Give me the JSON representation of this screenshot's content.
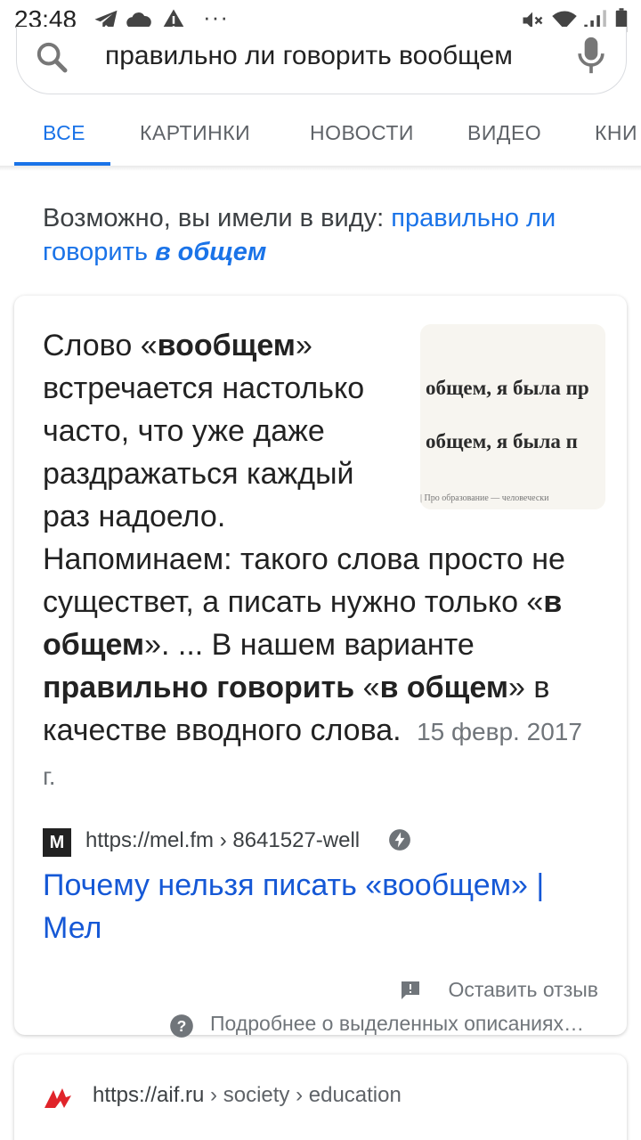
{
  "status_bar": {
    "time": "23:48",
    "dots": "···",
    "left_icons": [
      "telegram-icon",
      "cloud-icon",
      "warning-icon"
    ],
    "right_icons": [
      "mute-icon",
      "wifi-icon",
      "signal-icon",
      "battery-icon"
    ]
  },
  "search": {
    "query": "правильно ли говорить вообщем",
    "icons": [
      "search-icon",
      "mic-icon"
    ]
  },
  "tabs": [
    {
      "label": "ВСЕ",
      "active": true
    },
    {
      "label": "КАРТИНКИ",
      "active": false
    },
    {
      "label": "НОВОСТИ",
      "active": false
    },
    {
      "label": "ВИДЕО",
      "active": false
    },
    {
      "label": "КНИ",
      "active": false
    }
  ],
  "did_you_mean": {
    "prefix": "Возможно, вы имели в виду: ",
    "link_plain": "правильно ли говорить ",
    "link_bold": "в общем"
  },
  "featured_snippet": {
    "text_parts": [
      {
        "text": "Слово «",
        "bold": false
      },
      {
        "text": "вообщем",
        "bold": true
      },
      {
        "text": "» встречается настолько часто, что уже даже раздражаться каждый раз надоело. Напоминаем: такого слова просто не существет, а писать нужно только «",
        "bold": false
      },
      {
        "text": "в общем",
        "bold": true
      },
      {
        "text": "». ... В нашем варианте ",
        "bold": false
      },
      {
        "text": "правильно говорить",
        "bold": true
      },
      {
        "text": " «",
        "bold": false
      },
      {
        "text": "в общем",
        "bold": true
      },
      {
        "text": "» в качестве вводного слова.",
        "bold": false
      }
    ],
    "date": "15 февр. 2017 г.",
    "thumbnail": {
      "line1": "общем, я была пр",
      "line2": "общем, я была п",
      "caption": "| Про образование — человечески"
    },
    "source_url": "https://mel.fm › 8641527-well",
    "favicon_letter": "M",
    "title": "Почему нельзя писать «вообщем» | Мел",
    "feedback": "Оставить отзыв",
    "about": "Подробнее о выделенных описаниях…"
  },
  "second_result": {
    "url_domain": "https://aif.ru",
    "url_path": " › society › education",
    "favicon": "aif-logo"
  },
  "colors": {
    "accent": "#1a73e8",
    "link": "#1558d6",
    "muted": "#70757a"
  }
}
